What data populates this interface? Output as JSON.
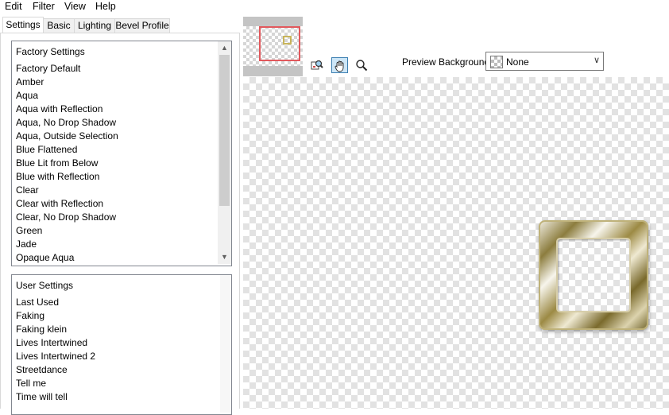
{
  "menu": [
    "Edit",
    "Filter",
    "View",
    "Help"
  ],
  "tabs": [
    "Settings",
    "Basic",
    "Lighting",
    "Bevel Profile"
  ],
  "factory_list": {
    "header": "Factory Settings",
    "items": [
      "Factory Default",
      "Amber",
      "Aqua",
      "Aqua with Reflection",
      "Aqua, No Drop Shadow",
      "Aqua, Outside Selection",
      "Blue Flattened",
      "Blue Lit from Below",
      "Blue with Reflection",
      "Clear",
      "Clear with Reflection",
      "Clear, No Drop Shadow",
      "Green",
      "Jade",
      "Opaque Aqua"
    ]
  },
  "user_list": {
    "header": "User Settings",
    "items": [
      "Last Used",
      "Faking",
      "Faking klein",
      "Lives Intertwined",
      "Lives Intertwined 2",
      "Streetdance",
      "Tell me",
      "Time will tell"
    ]
  },
  "toolbar": {
    "buttons": [
      "zoom-to-fit-icon",
      "hand-pan-icon",
      "magnifier-icon"
    ],
    "active": "hand-pan-icon"
  },
  "preview_background": {
    "label": "Preview Background:",
    "value": "None"
  },
  "colors": {
    "selection_border": "#e2585c",
    "active_tool": "#cde6f7",
    "bevel_gold": "#9c8a44"
  }
}
